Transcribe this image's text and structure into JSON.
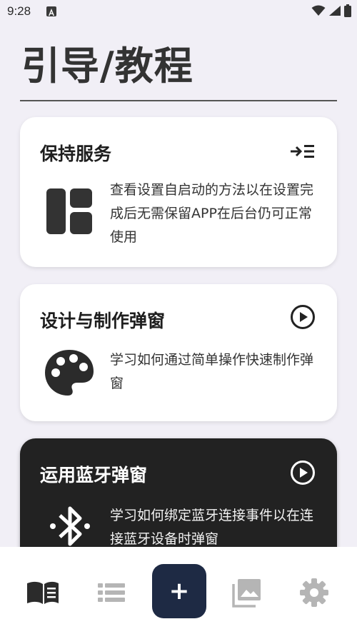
{
  "status_bar": {
    "time": "9:28",
    "notification_icon": "a-notification-icon",
    "icons": [
      "wifi-icon",
      "signal-icon",
      "battery-icon"
    ]
  },
  "page": {
    "title": "引导/教程"
  },
  "cards": [
    {
      "title": "保持服务",
      "body": "查看设置自启动的方法以在设置完成后无需保留APP在后台仍可正常使用",
      "icon": "dashboard-layout-icon",
      "action_icon": "indent-list-icon",
      "theme": "light"
    },
    {
      "title": "设计与制作弹窗",
      "body": "学习如何通过简单操作快速制作弹窗",
      "icon": "palette-icon",
      "action_icon": "play-circle-icon",
      "theme": "light"
    },
    {
      "title": "运用蓝牙弹窗",
      "body": "学习如何绑定蓝牙连接事件以在连接蓝牙设备时弹窗",
      "icon": "bluetooth-icon",
      "action_icon": "play-circle-icon",
      "theme": "dark"
    }
  ],
  "bottom_nav": {
    "items": [
      "guide-book-icon",
      "list-icon",
      "add-icon",
      "gallery-icon",
      "settings-icon"
    ],
    "fab_label": "+",
    "active": "guide-book-icon",
    "colors": {
      "active": "#2b2b2b",
      "inactive": "#b5b5b5",
      "fab": "#1e2a44"
    }
  }
}
